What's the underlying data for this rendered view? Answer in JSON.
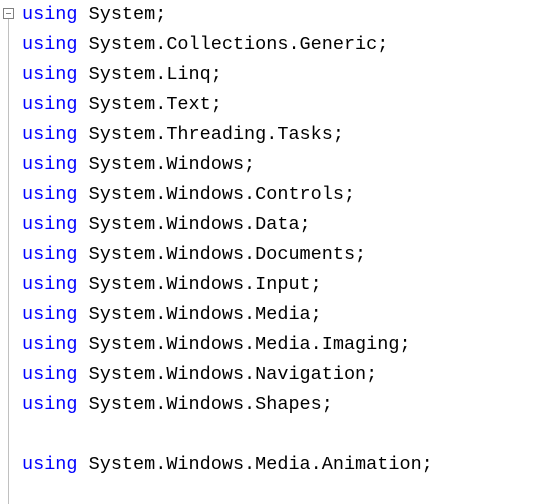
{
  "keyword": "using",
  "terminator": ";",
  "lines": [
    {
      "ns": "System"
    },
    {
      "ns": "System.Collections.Generic"
    },
    {
      "ns": "System.Linq"
    },
    {
      "ns": "System.Text"
    },
    {
      "ns": "System.Threading.Tasks"
    },
    {
      "ns": "System.Windows"
    },
    {
      "ns": "System.Windows.Controls"
    },
    {
      "ns": "System.Windows.Data"
    },
    {
      "ns": "System.Windows.Documents"
    },
    {
      "ns": "System.Windows.Input"
    },
    {
      "ns": "System.Windows.Media"
    },
    {
      "ns": "System.Windows.Media.Imaging"
    },
    {
      "ns": "System.Windows.Navigation"
    },
    {
      "ns": "System.Windows.Shapes"
    },
    {
      "blank": true
    },
    {
      "ns": "System.Windows.Media.Animation"
    }
  ]
}
